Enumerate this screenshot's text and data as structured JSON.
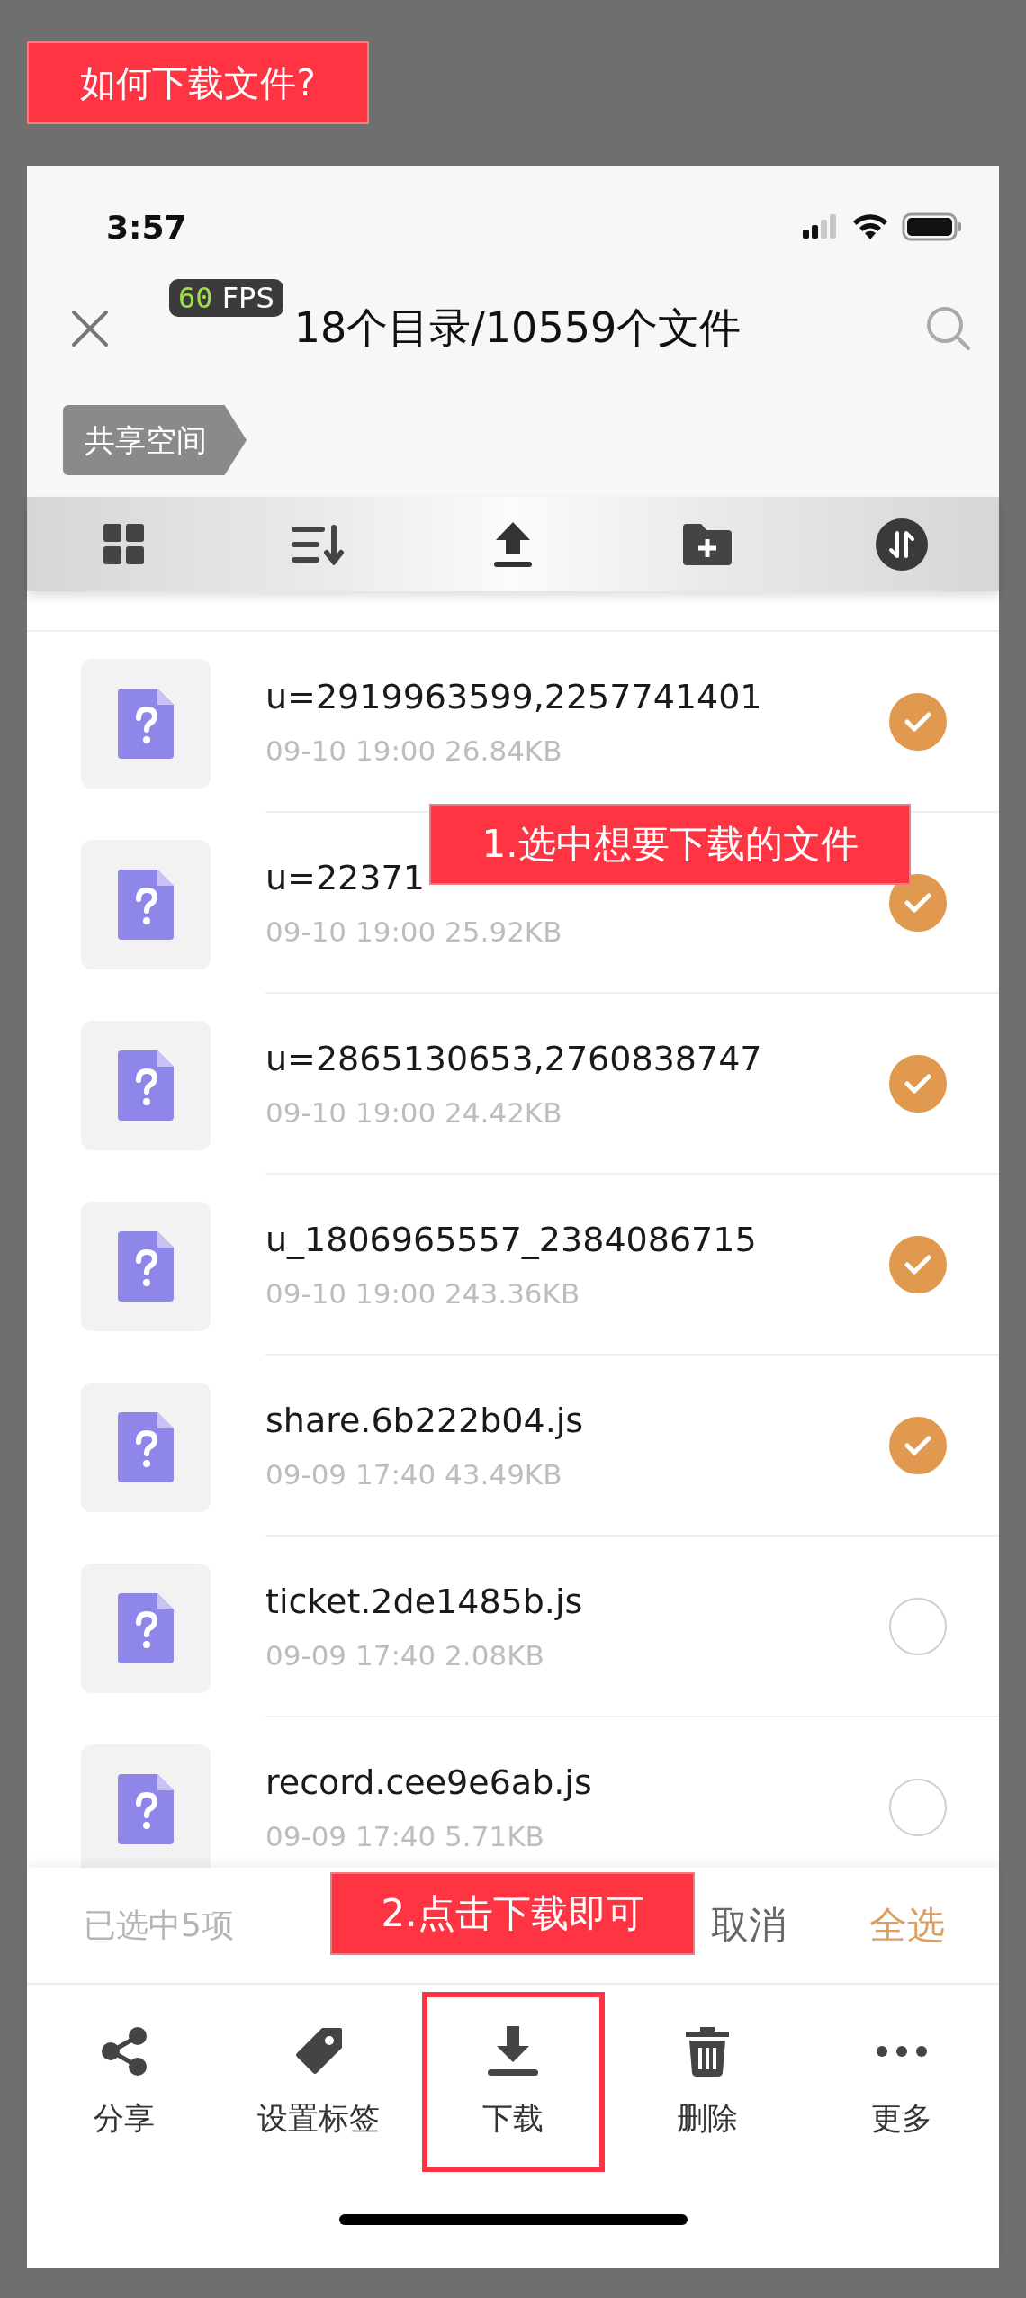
{
  "annotation_title": "如何下载文件?",
  "status_bar": {
    "time": "3:57"
  },
  "fps_badge": {
    "value": "60",
    "unit": "FPS"
  },
  "nav": {
    "title": "18个目录/10559个文件"
  },
  "breadcrumb": "共享空间",
  "files": [
    {
      "name": "u=2919963599,2257741401",
      "meta": "09-10 19:00 26.84KB",
      "selected": true
    },
    {
      "name": "u=22371",
      "meta": "09-10 19:00 25.92KB",
      "selected": true
    },
    {
      "name": "u=2865130653,2760838747",
      "meta": "09-10 19:00 24.42KB",
      "selected": true
    },
    {
      "name": "u_1806965557_2384086715",
      "meta": "09-10 19:00 243.36KB",
      "selected": true
    },
    {
      "name": "share.6b222b04.js",
      "meta": "09-09 17:40 43.49KB",
      "selected": true
    },
    {
      "name": "ticket.2de1485b.js",
      "meta": "09-09 17:40 2.08KB",
      "selected": false
    },
    {
      "name": "record.cee9e6ab.js",
      "meta": "09-09 17:40 5.71KB",
      "selected": false
    }
  ],
  "step_1": "1.选中想要下载的文件",
  "selection_bar": {
    "count": "已选中5项",
    "cancel": "取消",
    "select_all": "全选"
  },
  "step_2": "2.点击下载即可",
  "actions": [
    {
      "label": "分享",
      "highlighted": false
    },
    {
      "label": "设置标签",
      "highlighted": false
    },
    {
      "label": "下载",
      "highlighted": true
    },
    {
      "label": "删除",
      "highlighted": false
    },
    {
      "label": "更多",
      "highlighted": false
    }
  ]
}
